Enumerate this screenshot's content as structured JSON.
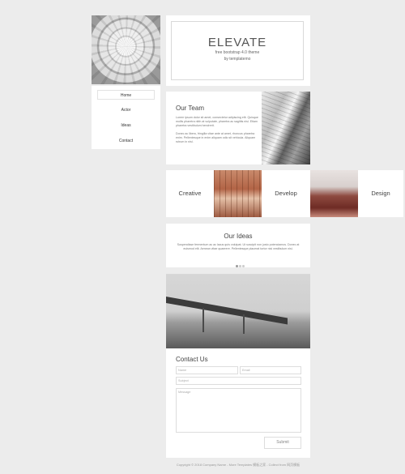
{
  "nav": {
    "items": [
      {
        "label": "Home",
        "active": true
      },
      {
        "label": "Actor",
        "active": false
      },
      {
        "label": "Ideas",
        "active": false
      },
      {
        "label": "Contact",
        "active": false
      }
    ]
  },
  "hero": {
    "title": "ELEVATE",
    "subtitle": "free bootstrap 4.0 theme",
    "byline": "by templatemo"
  },
  "team": {
    "heading": "Our Team",
    "paragraph1": "Lorem ipsum dolor sit amet, consectetur adipiscing elit. Quisque mollis pharetra nibh at vulputate, pharetra ac sagittis nisi. Etiam pharetra vestibulum hendrerit.",
    "paragraph2": "Donec ac libero, fringilla vitae ante at amet, rhoncus pharetra enim. Pellentesque in enim aliquam odio sit vehicula. Aliquam rutrum in nisl."
  },
  "features": {
    "creative": "Creative",
    "develop": "Develop",
    "design": "Design"
  },
  "ideas": {
    "heading": "Our Ideas",
    "text": "Suspendisse fermentum ac ac lacus quis volutpat. Ut suscipit non justo potenciamos. Donec at euismod elit. Aenean vitae quaerere. Pellentesque placerat tortor nisi vestibulum nisi."
  },
  "contact": {
    "heading": "Contact Us",
    "name_placeholder": "Name",
    "email_placeholder": "Email",
    "subject_placeholder": "Subject",
    "message_placeholder": "Message",
    "submit_label": "Submit"
  },
  "footer": {
    "text": "Copyright © 2018 Company Name - More Templates 模板之家 - Collect from 网页模板"
  }
}
